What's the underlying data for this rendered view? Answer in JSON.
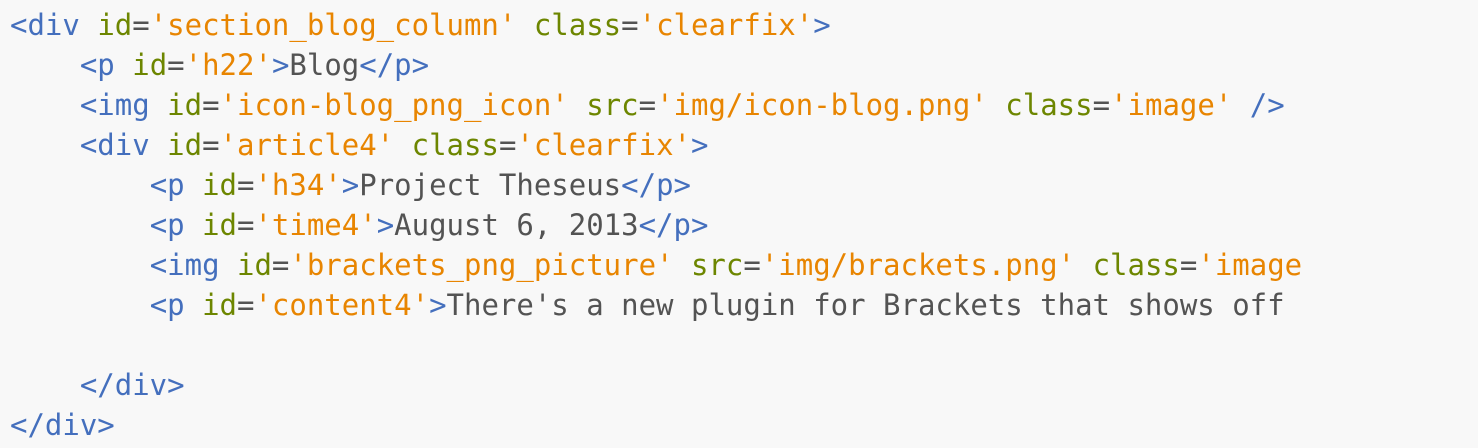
{
  "editor": {
    "top_partial": "-->",
    "lines": [
      {
        "indent": "",
        "tokens": [
          {
            "t": "tag",
            "v": "<div"
          },
          {
            "t": "txt",
            "v": " "
          },
          {
            "t": "attr",
            "v": "id"
          },
          {
            "t": "txt",
            "v": "="
          },
          {
            "t": "str",
            "v": "'section_blog_column'"
          },
          {
            "t": "txt",
            "v": " "
          },
          {
            "t": "attr",
            "v": "class"
          },
          {
            "t": "txt",
            "v": "="
          },
          {
            "t": "str",
            "v": "'clearfix'"
          },
          {
            "t": "tag",
            "v": ">"
          }
        ]
      },
      {
        "indent": "    ",
        "tokens": [
          {
            "t": "tag",
            "v": "<p"
          },
          {
            "t": "txt",
            "v": " "
          },
          {
            "t": "attr",
            "v": "id"
          },
          {
            "t": "txt",
            "v": "="
          },
          {
            "t": "str",
            "v": "'h22'"
          },
          {
            "t": "tag",
            "v": ">"
          },
          {
            "t": "txt",
            "v": "Blog"
          },
          {
            "t": "tag",
            "v": "</p>"
          }
        ]
      },
      {
        "indent": "    ",
        "tokens": [
          {
            "t": "tag",
            "v": "<img"
          },
          {
            "t": "txt",
            "v": " "
          },
          {
            "t": "attr",
            "v": "id"
          },
          {
            "t": "txt",
            "v": "="
          },
          {
            "t": "str",
            "v": "'icon-blog_png_icon'"
          },
          {
            "t": "txt",
            "v": " "
          },
          {
            "t": "attr",
            "v": "src"
          },
          {
            "t": "txt",
            "v": "="
          },
          {
            "t": "str",
            "v": "'img/icon-blog.png'"
          },
          {
            "t": "txt",
            "v": " "
          },
          {
            "t": "attr",
            "v": "class"
          },
          {
            "t": "txt",
            "v": "="
          },
          {
            "t": "str",
            "v": "'image'"
          },
          {
            "t": "txt",
            "v": " "
          },
          {
            "t": "tag",
            "v": "/>"
          }
        ]
      },
      {
        "indent": "    ",
        "tokens": [
          {
            "t": "tag",
            "v": "<div"
          },
          {
            "t": "txt",
            "v": " "
          },
          {
            "t": "attr",
            "v": "id"
          },
          {
            "t": "txt",
            "v": "="
          },
          {
            "t": "str",
            "v": "'article4'"
          },
          {
            "t": "txt",
            "v": " "
          },
          {
            "t": "attr",
            "v": "class"
          },
          {
            "t": "txt",
            "v": "="
          },
          {
            "t": "str",
            "v": "'clearfix'"
          },
          {
            "t": "tag",
            "v": ">"
          }
        ]
      },
      {
        "indent": "        ",
        "tokens": [
          {
            "t": "tag",
            "v": "<p"
          },
          {
            "t": "txt",
            "v": " "
          },
          {
            "t": "attr",
            "v": "id"
          },
          {
            "t": "txt",
            "v": "="
          },
          {
            "t": "str",
            "v": "'h34'"
          },
          {
            "t": "tag",
            "v": ">"
          },
          {
            "t": "txt",
            "v": "Project Theseus"
          },
          {
            "t": "tag",
            "v": "</p>"
          }
        ]
      },
      {
        "indent": "        ",
        "tokens": [
          {
            "t": "tag",
            "v": "<p"
          },
          {
            "t": "txt",
            "v": " "
          },
          {
            "t": "attr",
            "v": "id"
          },
          {
            "t": "txt",
            "v": "="
          },
          {
            "t": "str",
            "v": "'time4'"
          },
          {
            "t": "tag",
            "v": ">"
          },
          {
            "t": "txt",
            "v": "August 6, 2013"
          },
          {
            "t": "tag",
            "v": "</p>"
          }
        ]
      },
      {
        "indent": "        ",
        "tokens": [
          {
            "t": "tag",
            "v": "<img"
          },
          {
            "t": "txt",
            "v": " "
          },
          {
            "t": "attr",
            "v": "id"
          },
          {
            "t": "txt",
            "v": "="
          },
          {
            "t": "str",
            "v": "'brackets_png_picture'"
          },
          {
            "t": "txt",
            "v": " "
          },
          {
            "t": "attr",
            "v": "src"
          },
          {
            "t": "txt",
            "v": "="
          },
          {
            "t": "str",
            "v": "'img/brackets.png'"
          },
          {
            "t": "txt",
            "v": " "
          },
          {
            "t": "attr",
            "v": "class"
          },
          {
            "t": "txt",
            "v": "="
          },
          {
            "t": "str",
            "v": "'image"
          }
        ]
      },
      {
        "indent": "        ",
        "tokens": [
          {
            "t": "tag",
            "v": "<p"
          },
          {
            "t": "txt",
            "v": " "
          },
          {
            "t": "attr",
            "v": "id"
          },
          {
            "t": "txt",
            "v": "="
          },
          {
            "t": "str",
            "v": "'content4'"
          },
          {
            "t": "tag",
            "v": ">"
          },
          {
            "t": "txt",
            "v": "There's a new plugin for Brackets that shows off"
          }
        ]
      },
      {
        "indent": "",
        "tokens": []
      },
      {
        "indent": "    ",
        "tokens": [
          {
            "t": "tag",
            "v": "</div>"
          }
        ]
      },
      {
        "indent": "",
        "tokens": [
          {
            "t": "tag",
            "v": "</div>"
          }
        ]
      }
    ]
  },
  "colors": {
    "background": "#f8f8f8",
    "tag": "#446fbd",
    "attribute": "#6d8600",
    "string": "#e88501",
    "text": "#535353"
  }
}
